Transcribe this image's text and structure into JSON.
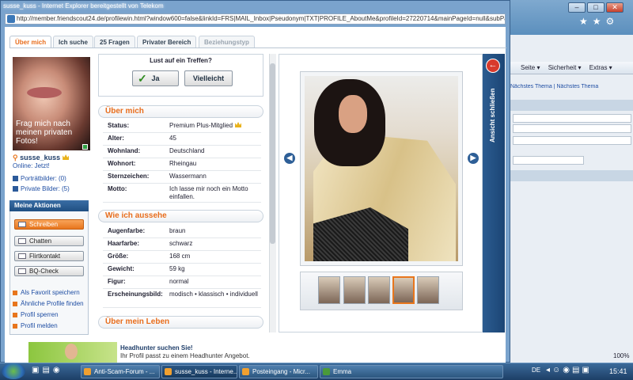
{
  "popup": {
    "title": "susse_kuss - Internet Explorer bereitgestellt von Telekom",
    "url": "http://member.friendscout24.de/profilewin.html?window600=false&linkId=FRS|MAIL_Inbox|Pseudonym|TXT|PROFILE_AboutMe&profileId=27220714&mainPageId=null&subPageId=null&"
  },
  "tabs": [
    "Über mich",
    "Ich suche",
    "25 Fragen",
    "Privater Bereich",
    "Beziehungstyp"
  ],
  "profile": {
    "photo_caption": "Frag mich nach meinen privaten Fotos!",
    "username": "susse_kuss",
    "online": "Online: Jetzt!",
    "portrait_pics": "Porträtbilder: (0)",
    "private_pics": "Private Bilder: (5)"
  },
  "actions": {
    "heading": "Meine Aktionen",
    "buttons": [
      "Schreiben",
      "Chatten",
      "Flirtkontakt",
      "BQ-Check"
    ],
    "links": [
      "Als Favorit speichern",
      "Ähnliche Profile finden",
      "Profil sperren",
      "Profil melden"
    ]
  },
  "meeting": {
    "question": "Lust auf ein Treffen?",
    "yes": "Ja",
    "maybe": "Vielleicht"
  },
  "about": {
    "heading": "Über mich",
    "rows": [
      {
        "k": "Status:",
        "v": "Premium Plus-Mitglied"
      },
      {
        "k": "Alter:",
        "v": "45"
      },
      {
        "k": "Wohnland:",
        "v": "Deutschland"
      },
      {
        "k": "Wohnort:",
        "v": "Rheingau"
      },
      {
        "k": "Sternzeichen:",
        "v": "Wassermann"
      },
      {
        "k": "Motto:",
        "v": "Ich lasse mir noch ein Motto einfallen."
      }
    ]
  },
  "looks": {
    "heading": "Wie ich aussehe",
    "rows": [
      {
        "k": "Augenfarbe:",
        "v": "braun"
      },
      {
        "k": "Haarfarbe:",
        "v": "schwarz"
      },
      {
        "k": "Größe:",
        "v": "168 cm"
      },
      {
        "k": "Gewicht:",
        "v": "59 kg"
      },
      {
        "k": "Figur:",
        "v": "normal"
      },
      {
        "k": "Erscheinungsbild:",
        "v": "modisch  •  klassisch  •  individuell"
      }
    ]
  },
  "life": {
    "heading": "Über mein Leben"
  },
  "ad": {
    "title": "Headhunter suchen Sie!",
    "text": "Ihr Profil passt zu einem Headhunter Angebot."
  },
  "viewer": {
    "close_label": "Ansicht schließen"
  },
  "bg_window": {
    "toolbar": [
      "Seite ▾",
      "Sicherheit ▾",
      "Extras ▾"
    ],
    "thread_nav": "Nächstes Thema | Nächstes Thema"
  },
  "taskbar": {
    "tasks": [
      "Anti-Scam-Forum - ...",
      "susse_kuss - Interne...",
      "Posteingang - Micr...",
      "Emma"
    ],
    "lang": "DE",
    "clock": "15:41",
    "zoom": "100%"
  }
}
